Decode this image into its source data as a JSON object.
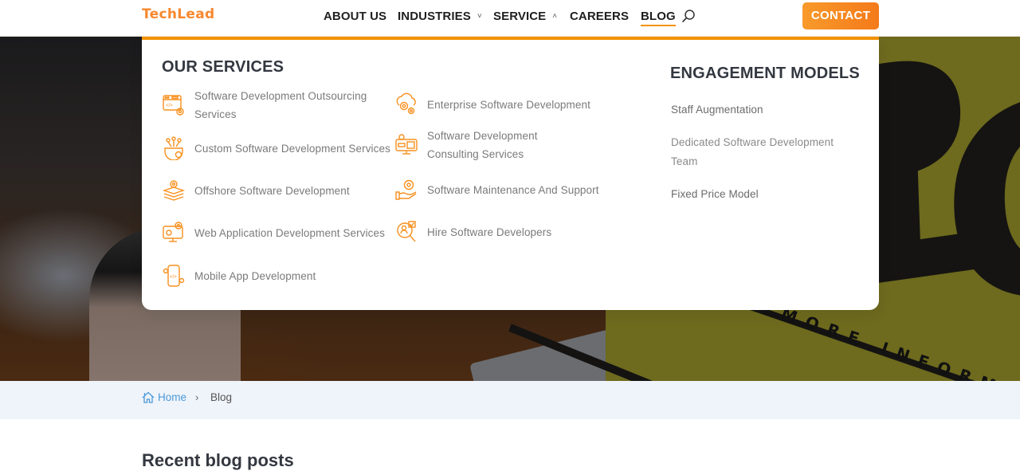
{
  "header": {
    "logo": "TechLead",
    "nav": [
      {
        "label": "ABOUT US",
        "has_chevron": false,
        "chevron": ""
      },
      {
        "label": "INDUSTRIES",
        "has_chevron": true,
        "chevron": "˅"
      },
      {
        "label": "SERVICE",
        "has_chevron": true,
        "chevron": "˄"
      },
      {
        "label": "CAREERS",
        "has_chevron": false,
        "chevron": ""
      },
      {
        "label": "BLOG",
        "has_chevron": false,
        "chevron": "",
        "active": true
      }
    ],
    "search_icon": "search-icon",
    "contact_label": "CONTACT",
    "accent_color": "#f39200"
  },
  "dropdown": {
    "services_title": "OUR SERVICES",
    "services_col1": [
      {
        "label": "Software Development Outsourcing Services",
        "icon": "code-window-gear-icon"
      },
      {
        "label": "Custom Software Development Services",
        "icon": "custom-gear-network-icon"
      },
      {
        "label": "Offshore Software Development",
        "icon": "layers-gear-icon"
      },
      {
        "label": "Web Application Development Services",
        "icon": "monitor-gears-icon"
      },
      {
        "label": "Mobile App Development",
        "icon": "mobile-code-icon"
      }
    ],
    "services_col2": [
      {
        "label": "Enterprise Software Development",
        "icon": "cloud-gears-icon"
      },
      {
        "label": "Software Development Consulting Services",
        "icon": "monitor-gear-code-icon"
      },
      {
        "label": "Software Maintenance And Support",
        "icon": "hand-gear-icon"
      },
      {
        "label": "Hire Software Developers",
        "icon": "search-person-icon"
      }
    ],
    "engagement_title": "ENGAGEMENT MODELS",
    "engagement_items": [
      {
        "label": "Staff Augmentation"
      },
      {
        "label": "Dedicated Software Development Team"
      },
      {
        "label": "Fixed Price Model"
      }
    ]
  },
  "hero": {
    "sign_text": "MORE INFORMATION",
    "sign_letters": "PLO"
  },
  "breadcrumb": {
    "home": "Home",
    "separator": "›",
    "current": "Blog"
  },
  "main": {
    "section_title": "Recent blog posts"
  }
}
